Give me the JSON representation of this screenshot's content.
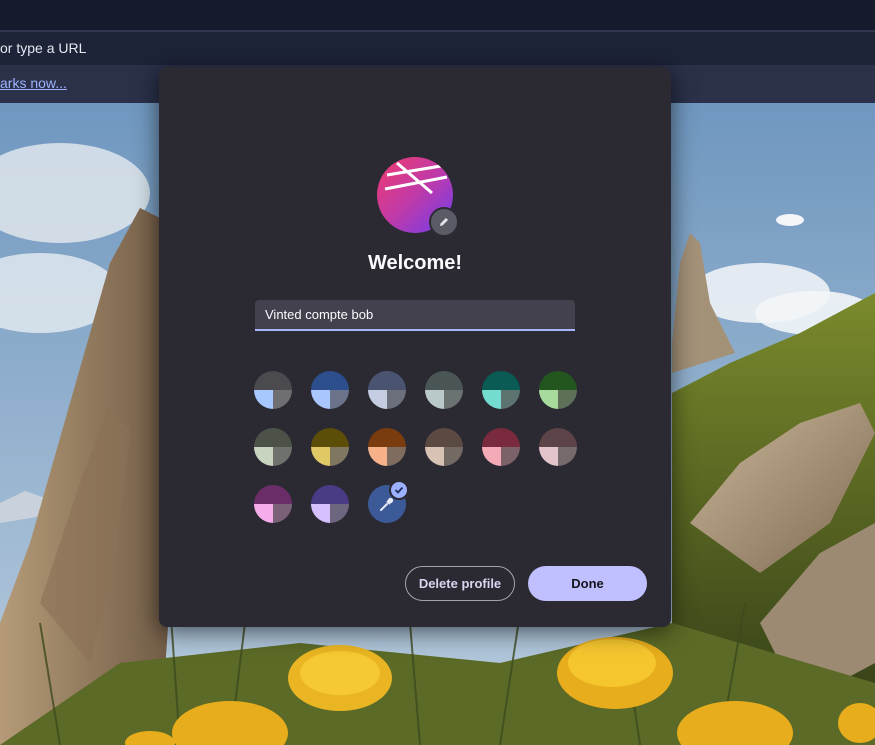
{
  "browser": {
    "url_placeholder_visible": "or type a URL",
    "bookmarks_link": "arks now..."
  },
  "dialog": {
    "title": "Welcome!",
    "profile_name_value": "Vinted compte bob",
    "avatar_icon": "profile-avatar-image",
    "edit_icon": "pencil-icon",
    "themes": [
      {
        "name": "theme-gray",
        "colors": [
          "#4b4b4f",
          "#a7c8ff",
          "#6f6f73"
        ]
      },
      {
        "name": "theme-blue",
        "colors": [
          "#2d4e8c",
          "#a9c6ff",
          "#6a7389"
        ]
      },
      {
        "name": "theme-slate",
        "colors": [
          "#4a5470",
          "#c5cde3",
          "#6c6f7c"
        ]
      },
      {
        "name": "theme-teal-gray",
        "colors": [
          "#4a5556",
          "#b9c9c9",
          "#6b7272"
        ]
      },
      {
        "name": "theme-teal",
        "colors": [
          "#0a5b54",
          "#74dccf",
          "#5d7370"
        ]
      },
      {
        "name": "theme-green",
        "colors": [
          "#23551f",
          "#a8d99d",
          "#5f7058"
        ]
      },
      {
        "name": "theme-sage",
        "colors": [
          "#4d5249",
          "#c8d3c0",
          "#6f726c"
        ]
      },
      {
        "name": "theme-olive",
        "colors": [
          "#5c4d09",
          "#e1c866",
          "#807760"
        ]
      },
      {
        "name": "theme-orange",
        "colors": [
          "#7a3c0f",
          "#f6b18a",
          "#806b5f"
        ]
      },
      {
        "name": "theme-brown",
        "colors": [
          "#5b4a42",
          "#d8c2b4",
          "#746a64"
        ]
      },
      {
        "name": "theme-rose",
        "colors": [
          "#7a2a3e",
          "#f5aab8",
          "#7d6168"
        ]
      },
      {
        "name": "theme-mauve",
        "colors": [
          "#5c4348",
          "#e2c4ca",
          "#766a6c"
        ]
      },
      {
        "name": "theme-plum",
        "colors": [
          "#6b2d68",
          "#f6acea",
          "#7a6178"
        ]
      },
      {
        "name": "theme-violet",
        "colors": [
          "#4b3a86",
          "#d5c1ff",
          "#6e667f"
        ]
      }
    ],
    "custom_theme_icon": "eyedropper-icon",
    "selected_icon": "checkmark-icon",
    "delete_label": "Delete profile",
    "done_label": "Done"
  }
}
